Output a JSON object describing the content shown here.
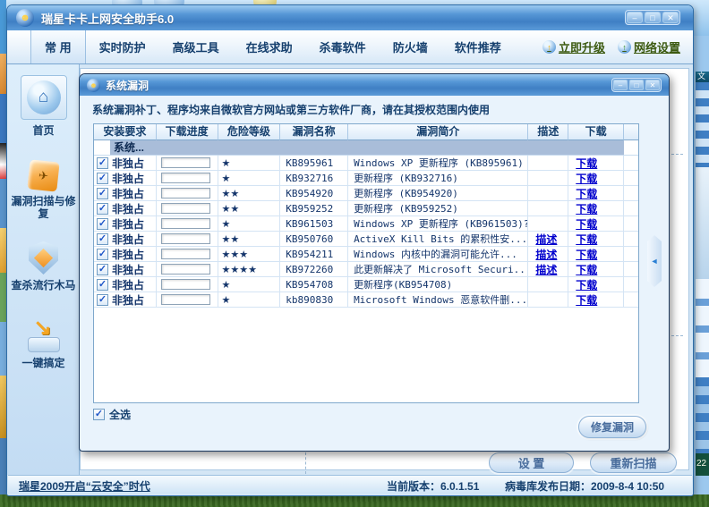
{
  "window": {
    "title": "瑞星卡卡上网安全助手6.0",
    "tabs": [
      {
        "label": "常 用",
        "active": true
      },
      {
        "label": "实时防护",
        "active": false
      },
      {
        "label": "高级工具",
        "active": false
      },
      {
        "label": "在线求助",
        "active": false
      },
      {
        "label": "杀毒软件",
        "active": false
      },
      {
        "label": "防火墙",
        "active": false
      },
      {
        "label": "软件推荐",
        "active": false
      }
    ],
    "links": {
      "upgrade": "立即升级",
      "network": "网络设置"
    },
    "sidebar": [
      {
        "label": "首页",
        "selected": true
      },
      {
        "label": "漏洞扫描与修复",
        "selected": false
      },
      {
        "label": "查杀流行木马",
        "selected": false
      },
      {
        "label": "一键搞定",
        "selected": false
      }
    ],
    "footer_buttons": {
      "settings": "设 置",
      "rescan": "重新扫描"
    },
    "statusbar": {
      "promo": "瑞星2009开启“云安全”时代",
      "version": "当前版本：6.0.1.51",
      "virus_db": "病毒库发布日期：2009-8-4 10:50"
    }
  },
  "dialog": {
    "title": "系统漏洞",
    "notice": "系统漏洞补丁、程序均来自微软官方网站或第三方软件厂商，请在其授权范围内使用",
    "table": {
      "headers": [
        "安装要求",
        "下载进度",
        "危险等级",
        "漏洞名称",
        "漏洞简介",
        "描述",
        "下载"
      ],
      "group_label": "系统...",
      "desc_link_label": "描述",
      "download_label": "下载",
      "rows": [
        {
          "requirement": "非独占",
          "progress": 0,
          "risk_stars": 1,
          "name": "KB895961",
          "summary": "Windows XP 更新程序 (KB895961)",
          "has_description": false
        },
        {
          "requirement": "非独占",
          "progress": 0,
          "risk_stars": 1,
          "name": "KB932716",
          "summary": "更新程序 (KB932716)",
          "has_description": false
        },
        {
          "requirement": "非独占",
          "progress": 0,
          "risk_stars": 2,
          "name": "KB954920",
          "summary": "更新程序 (KB954920)",
          "has_description": false
        },
        {
          "requirement": "非独占",
          "progress": 0,
          "risk_stars": 2,
          "name": "KB959252",
          "summary": "更新程序 (KB959252)",
          "has_description": false
        },
        {
          "requirement": "非独占",
          "progress": 0,
          "risk_stars": 1,
          "name": "KB961503",
          "summary": "Windows XP 更新程序 (KB961503)?",
          "has_description": false
        },
        {
          "requirement": "非独占",
          "progress": 0,
          "risk_stars": 2,
          "name": "KB950760",
          "summary": "ActiveX Kill Bits 的累积性安...",
          "has_description": true
        },
        {
          "requirement": "非独占",
          "progress": 0,
          "risk_stars": 3,
          "name": "KB954211",
          "summary": "Windows 内核中的漏洞可能允许...",
          "has_description": true
        },
        {
          "requirement": "非独占",
          "progress": 0,
          "risk_stars": 4,
          "name": "KB972260",
          "summary": "此更新解决了 Microsoft Securi...",
          "has_description": true
        },
        {
          "requirement": "非独占",
          "progress": 0,
          "risk_stars": 1,
          "name": "KB954708",
          "summary": "更新程序(KB954708)",
          "has_description": false
        },
        {
          "requirement": "非独占",
          "progress": 0,
          "risk_stars": 1,
          "name": "kb890830",
          "summary": "Microsoft Windows 恶意软件删...",
          "has_description": false
        }
      ]
    },
    "select_all": "全选",
    "repair_button": "修复漏洞"
  },
  "icons": {
    "minimize": "–",
    "maximize": "□",
    "close": "✕",
    "check": "✓",
    "star": "★",
    "home": "⌂",
    "collapse_left": "◄",
    "up_arrow": "↑",
    "down_arrow": "↘",
    "plane": "✈",
    "face": "☻"
  },
  "background_fragments": {
    "right_window_top": "文",
    "right_window_bottom": "22"
  },
  "colors": {
    "titlebar_blue": "#4d8ed2",
    "accent_navy": "#16406e",
    "link_blue": "#0000cd",
    "upgrade_link_green": "#3c5a10",
    "group_row_blue": "#a9bdd9",
    "grass_green": "#3f6b2c"
  }
}
